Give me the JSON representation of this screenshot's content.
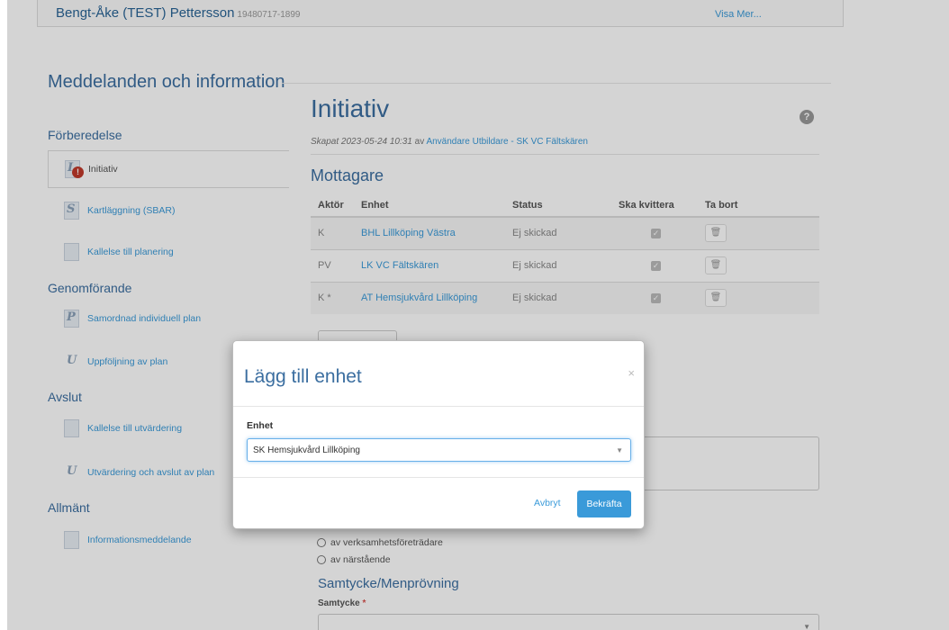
{
  "patient": {
    "name": "Bengt-Åke (TEST) Pettersson",
    "id": "19480717-1899",
    "more_link": "Visa Mer..."
  },
  "section_title": "Meddelanden och information",
  "sidebar": {
    "groups": [
      {
        "title": "Förberedelse"
      },
      {
        "title": "Genomförande"
      },
      {
        "title": "Avslut"
      },
      {
        "title": "Allmänt"
      }
    ],
    "items": [
      {
        "label": "Initiativ",
        "icon": "initiative-icon",
        "active": true
      },
      {
        "label": "Kartläggning (SBAR)",
        "icon": "survey-icon"
      },
      {
        "label": "Kallelse till planering",
        "icon": "invitation-icon"
      },
      {
        "label": "Samordnad individuell plan",
        "icon": "plan-icon"
      },
      {
        "label": "Uppföljning av plan",
        "icon": "followup-icon"
      },
      {
        "label": "Kallelse till utvärdering",
        "icon": "evaluation-invite-icon"
      },
      {
        "label": "Utvärdering och avslut av plan",
        "icon": "evaluation-icon"
      },
      {
        "label": "Informationsmeddelande",
        "icon": "info-message-icon"
      }
    ]
  },
  "main": {
    "title": "Initiativ",
    "meta_prefix": "Skapat 2023-05-24 10:31",
    "meta_by": "av",
    "meta_author": "Användare Utbildare - SK VC Fältskären",
    "recipients_title": "Mottagare",
    "table": {
      "headers": [
        "Aktör",
        "Enhet",
        "Status",
        "Ska kvittera",
        "Ta bort"
      ],
      "rows": [
        {
          "actor": "K",
          "unit": "BHL Lillköping Västra",
          "status": "Ej skickad"
        },
        {
          "actor": "PV",
          "unit": "LK VC Fältskären",
          "status": "Ej skickad"
        },
        {
          "actor": "K *",
          "unit": "AT Hemsjukvård Lillköping",
          "status": "Ej skickad"
        }
      ]
    },
    "radio_options": [
      "av verksamhetsföreträdare",
      "av närstående"
    ],
    "consent_title": "Samtycke/Menprövning",
    "consent_label": "Samtycke",
    "required_mark": "*"
  },
  "modal": {
    "title": "Lägg till enhet",
    "close": "×",
    "field_label": "Enhet",
    "selected_value": "SK Hemsjukvård Lillköping",
    "cancel_label": "Avbryt",
    "confirm_label": "Bekräfta"
  },
  "colors": {
    "accent": "#3a9ad9",
    "heading": "#3b6ea0",
    "alert": "#c0392b"
  }
}
